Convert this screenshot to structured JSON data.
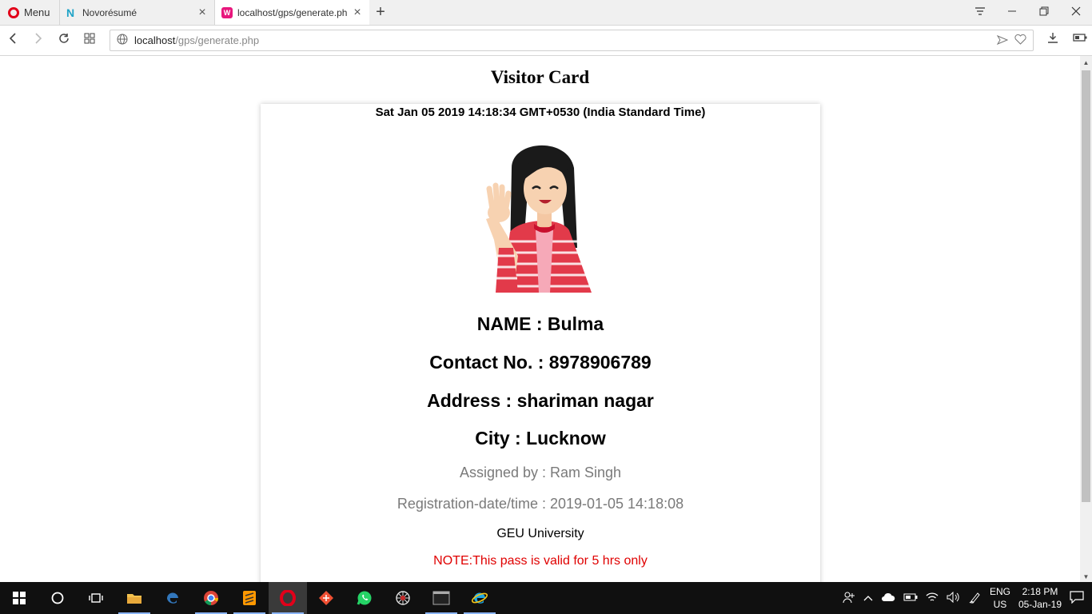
{
  "browser": {
    "menu_label": "Menu",
    "tabs": [
      {
        "title": "Novorésumé",
        "close": "×"
      },
      {
        "title": "localhost/gps/generate.php",
        "close": "×"
      }
    ],
    "new_tab": "+",
    "url_host": "localhost",
    "url_path": "/gps/generate.php"
  },
  "page": {
    "title": "Visitor Card",
    "date": "Sat Jan 05 2019 14:18:34 GMT+0530 (India Standard Time)",
    "name_line": "NAME : Bulma",
    "contact_line": "Contact No. : 8978906789",
    "address_line": "Address : shariman nagar",
    "city_line": "City : Lucknow",
    "assigned_line": "Assigned by : Ram Singh",
    "registration_line": "Registration-date/time : 2019-01-05 14:18:08",
    "university": "GEU University",
    "note": "NOTE:This pass is valid for 5 hrs only"
  },
  "taskbar": {
    "lang_top": "ENG",
    "lang_bottom": "US",
    "time": "2:18 PM",
    "date": "05-Jan-19"
  },
  "colors": {
    "note": "#e00000",
    "opera_red": "#e2001a",
    "taskbar": "#101010"
  }
}
